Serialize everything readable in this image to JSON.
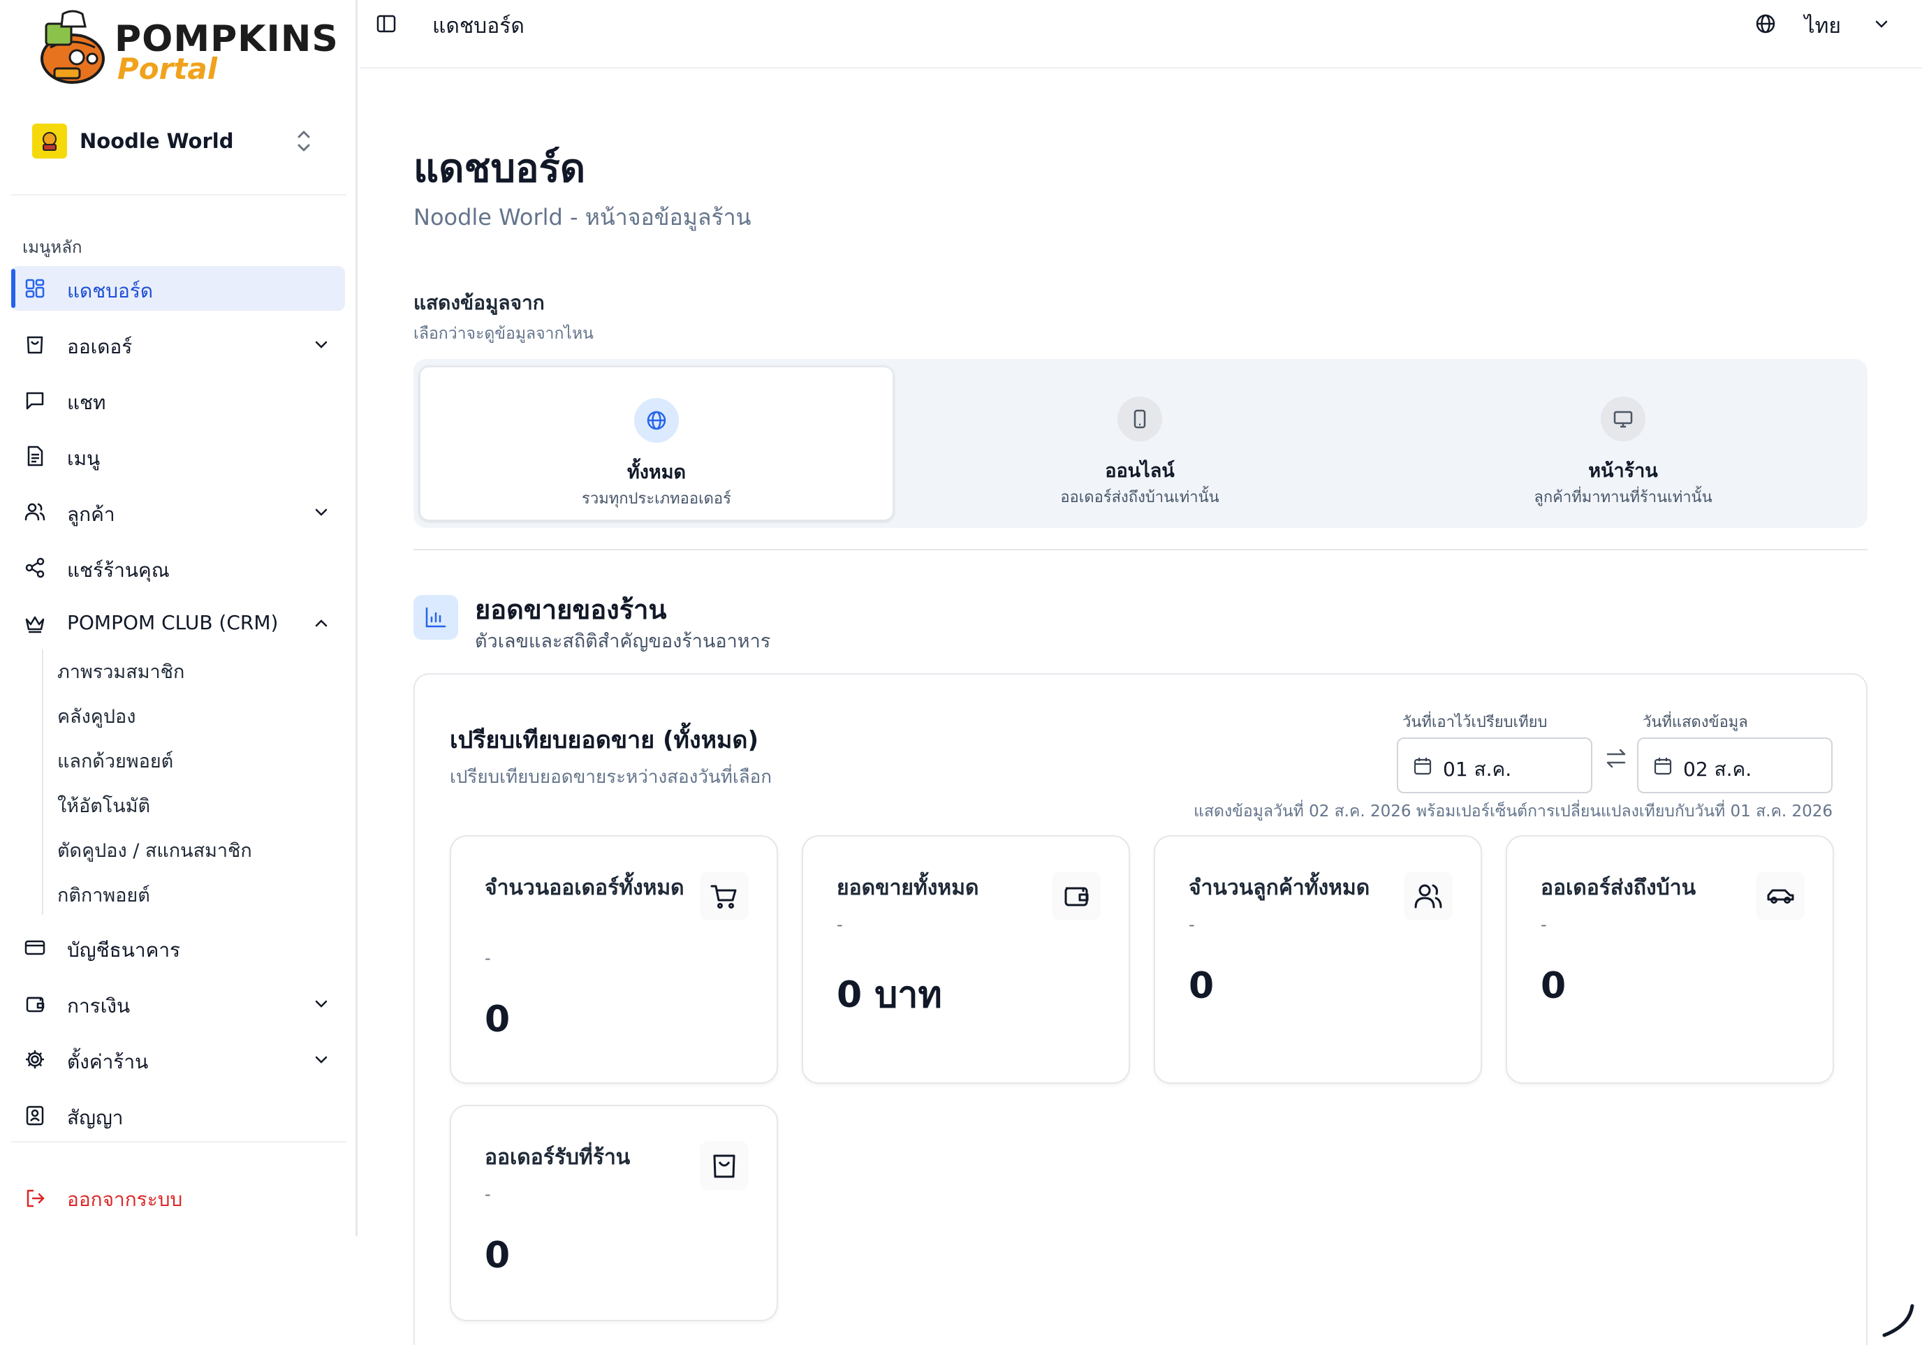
{
  "brand": {
    "title": "POMPKINS",
    "subtitle": "Portal"
  },
  "store": {
    "name": "Noodle World"
  },
  "sidebar": {
    "section_label": "เมนูหลัก",
    "items": [
      {
        "label": "แดชบอร์ด",
        "icon": "layout-grid-icon"
      },
      {
        "label": "ออเดอร์",
        "icon": "shopping-bag-icon"
      },
      {
        "label": "แชท",
        "icon": "chat-icon"
      },
      {
        "label": "เมนู",
        "icon": "document-icon"
      },
      {
        "label": "ลูกค้า",
        "icon": "users-icon"
      },
      {
        "label": "แชร์ร้านคุณ",
        "icon": "share-icon"
      },
      {
        "label": "POMPOM CLUB (CRM)",
        "icon": "crown-icon"
      },
      {
        "label": "บัญชีธนาคาร",
        "icon": "credit-card-icon"
      },
      {
        "label": "การเงิน",
        "icon": "wallet-icon"
      },
      {
        "label": "ตั้งค่าร้าน",
        "icon": "gear-icon"
      },
      {
        "label": "สัญญา",
        "icon": "contract-icon"
      }
    ],
    "crm_sub_items": [
      "ภาพรวมสมาชิก",
      "คลังคูปอง",
      "แลกด้วยพอยต์",
      "ให้อัตโนมัติ",
      "ตัดคูปอง / สแกนสมาชิก",
      "กติกาพอยต์"
    ],
    "logout": "ออกจากระบบ"
  },
  "topbar": {
    "title": "แดชบอร์ด",
    "language": "ไทย"
  },
  "page": {
    "title": "แดชบอร์ด",
    "subtitle": "Noodle World - หน้าจอข้อมูลร้าน"
  },
  "data_source": {
    "title": "แสดงข้อมูลจาก",
    "description": "เลือกว่าจะดูข้อมูลจากไหน",
    "options": [
      {
        "label": "ทั้งหมด",
        "description": "รวมทุกประเภทออเดอร์",
        "icon": "globe-icon",
        "selected": true
      },
      {
        "label": "ออนไลน์",
        "description": "ออเดอร์ส่งถึงบ้านเท่านั้น",
        "icon": "mobile-icon",
        "selected": false
      },
      {
        "label": "หน้าร้าน",
        "description": "ลูกค้าที่มาทานที่ร้านเท่านั้น",
        "icon": "monitor-icon",
        "selected": false
      }
    ]
  },
  "sales": {
    "title": "ยอดขายของร้าน",
    "description": "ตัวเลขและสถิติสำคัญของร้านอาหาร",
    "compare_title": "เปรียบเทียบยอดขาย (ทั้งหมด)",
    "compare_description": "เปรียบเทียบยอดขายระหว่างสองวันที่เลือก",
    "compare_date_label": "วันที่เอาไว้เปรียบเทียบ",
    "compare_date_value": "01 ส.ค.",
    "display_date_label": "วันที่แสดงข้อมูล",
    "display_date_value": "02 ส.ค.",
    "range_note": "แสดงข้อมูลวันที่ 02 ส.ค. 2026 พร้อมเปอร์เซ็นต์การเปลี่ยนแปลงเทียบกับวันที่ 01 ส.ค. 2026",
    "cards": [
      {
        "label": "จำนวนออเดอร์ทั้งหมด",
        "change": "-",
        "value": "0",
        "icon": "cart-icon"
      },
      {
        "label": "ยอดขายทั้งหมด",
        "change": "-",
        "value": "0 บาท",
        "icon": "wallet-icon"
      },
      {
        "label": "จำนวนลูกค้าทั้งหมด",
        "change": "-",
        "value": "0",
        "icon": "users-icon"
      },
      {
        "label": "ออเดอร์ส่งถึงบ้าน",
        "change": "-",
        "value": "0",
        "icon": "car-icon"
      },
      {
        "label": "ออเดอร์รับที่ร้าน",
        "change": "-",
        "value": "0",
        "icon": "shopping-bag-icon"
      }
    ]
  },
  "colors": {
    "accent": "#2563eb",
    "active_bg": "#e8eefb",
    "logout": "#dc2626",
    "brand_orange": "#f0a21c"
  }
}
